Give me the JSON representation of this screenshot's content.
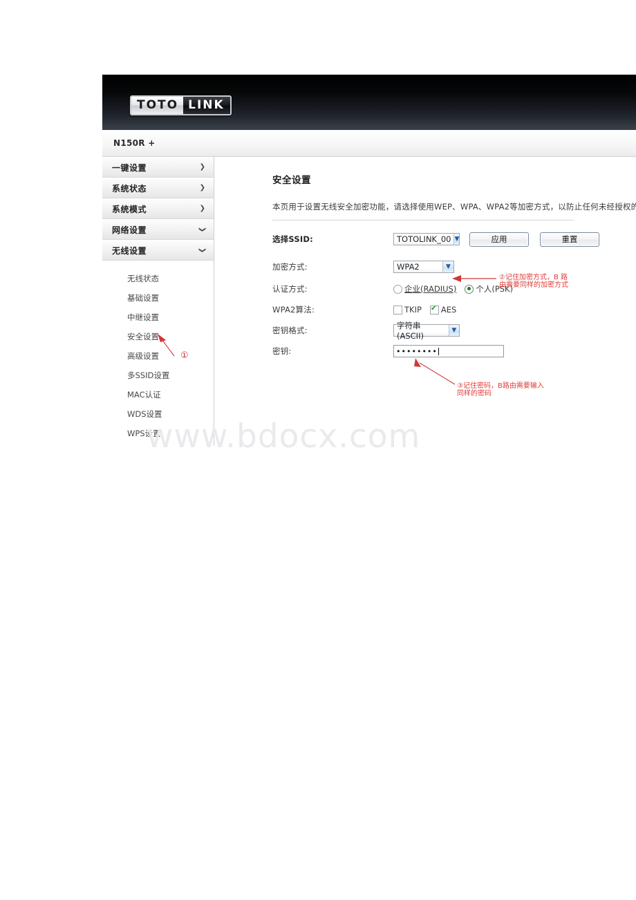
{
  "brand": {
    "logo_left": "TOTO",
    "logo_right": "LINK",
    "model": "N150R +"
  },
  "sidebar": {
    "top_items": [
      {
        "label": "一键设置",
        "chevron": "chevron-right",
        "glyph": "❯"
      },
      {
        "label": "系统状态",
        "chevron": "chevron-right",
        "glyph": "❯"
      },
      {
        "label": "系统模式",
        "chevron": "chevron-right",
        "glyph": "❯"
      },
      {
        "label": "网络设置",
        "chevron": "chevron-down",
        "glyph": "❮"
      },
      {
        "label": "无线设置",
        "chevron": "chevron-down",
        "glyph": "❮"
      }
    ],
    "sub_items": [
      {
        "label": "无线状态"
      },
      {
        "label": "基础设置"
      },
      {
        "label": "中继设置"
      },
      {
        "label": "安全设置"
      },
      {
        "label": "高级设置"
      },
      {
        "label": "多SSID设置"
      },
      {
        "label": "MAC认证"
      },
      {
        "label": "WDS设置"
      },
      {
        "label": "WPS设置"
      }
    ]
  },
  "main": {
    "title": "安全设置",
    "description": "本页用于设置无线安全加密功能，请选择使用WEP、WPA、WPA2等加密方式，以防止任何未经授权的",
    "ssid": {
      "label": "选择SSID:",
      "value": "TOTOLINK_00",
      "caret": "▼",
      "apply_button": "应用",
      "reset_button": "重置"
    },
    "encryption": {
      "label": "加密方式:",
      "value": "WPA2",
      "caret": "▼"
    },
    "auth": {
      "label": "认证方式:",
      "option_enterprise": "企业(RADIUS)",
      "option_personal": "个人(PSK)",
      "selected": "个人(PSK)"
    },
    "algorithm": {
      "label": "WPA2算法:",
      "option_tkip": "TKIP",
      "option_aes": "AES",
      "tkip_checked": false,
      "aes_checked": true
    },
    "key_format": {
      "label": "密钥格式:",
      "value": "字符串(ASCII)",
      "caret": "▼"
    },
    "key": {
      "label": "密钥:",
      "value": "••••••••"
    }
  },
  "annotations": {
    "marker_one": "①",
    "note_two_line1": "②记住加密方式，B 路",
    "note_two_line2": "由需要同样的加密方式",
    "note_three_line1": "③记住密码，B路由需要输入",
    "note_three_line2": "同样的密码"
  },
  "watermark": {
    "text": "www.bdocx.com"
  },
  "colors": {
    "annotation_red": "#e03b3b",
    "banner_black": "#000000",
    "check_green": "#1f9e3a",
    "watermark_grey": "#e9eaec"
  }
}
